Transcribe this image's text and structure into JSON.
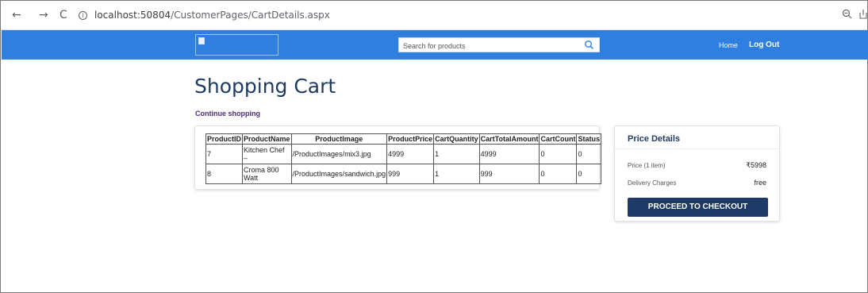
{
  "browser": {
    "back": "←",
    "forward": "→",
    "reload": "C",
    "url_host": "localhost:50804",
    "url_path": "/CustomerPages/CartDetails.aspx"
  },
  "header": {
    "search_placeholder": "Search for products",
    "nav": {
      "home": "Home",
      "logout": "Log Out"
    },
    "accent_color": "#2f7fe0"
  },
  "page": {
    "title": "Shopping Cart",
    "continue_link": "Continue shopping"
  },
  "cart_table": {
    "columns": [
      "ProductID",
      "ProductName",
      "ProductImage",
      "ProductPrice",
      "CartQuantity",
      "CartTotalAmount",
      "CartCount",
      "Status"
    ],
    "rows": [
      [
        "7",
        "Kitchen Chef –",
        "/ProductImages/mix3.jpg",
        "4999",
        "1",
        "4999",
        "0",
        "0"
      ],
      [
        "8",
        "Croma 800 Watt",
        "/ProductImages/sandwich.jpg",
        "999",
        "1",
        "999",
        "0",
        "0"
      ]
    ]
  },
  "price_details": {
    "title": "Price Details",
    "price_label": "Price (1 item)",
    "price_value": "₹5998",
    "delivery_label": "Delivery Charges",
    "delivery_value": "free",
    "checkout_button": "PROCEED TO CHECKOUT",
    "button_color": "#1e3a66"
  }
}
